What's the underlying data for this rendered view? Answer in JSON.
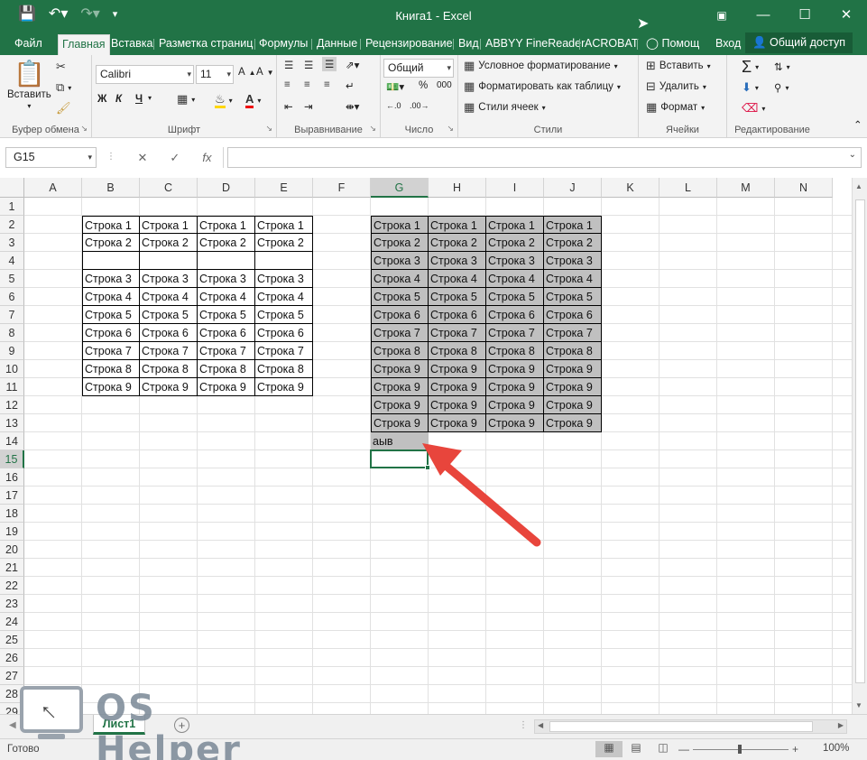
{
  "window": {
    "title": "Книга1 - Excel",
    "qat": [
      "save-icon",
      "undo-icon",
      "redo-icon",
      "customize-icon"
    ],
    "controls": [
      "ribbon-display-icon",
      "minimize-icon",
      "maximize-icon",
      "close-icon"
    ]
  },
  "tabs": [
    "Файл",
    "Главная",
    "Вставка",
    "Разметка страниц",
    "Формулы",
    "Данные",
    "Рецензирование",
    "Вид",
    "ABBYY FineReader",
    "ACROBAT"
  ],
  "tell_me": "Помощ",
  "sign_in": "Вход",
  "share": "Общий доступ",
  "ribbon": {
    "clipboard": {
      "paste": "Вставить",
      "label": "Буфер обмена"
    },
    "font": {
      "name": "Calibri",
      "size": "11",
      "bold": "Ж",
      "italic": "К",
      "underline": "Ч",
      "label": "Шрифт"
    },
    "alignment": {
      "label": "Выравнивание"
    },
    "number": {
      "format": "Общий",
      "label": "Число",
      "percent": "%",
      "thousands": "000"
    },
    "styles": {
      "conditional": "Условное форматирование",
      "as_table": "Форматировать как таблицу",
      "cell_styles": "Стили ячеек",
      "label": "Стили"
    },
    "cells": {
      "insert": "Вставить",
      "delete": "Удалить",
      "format": "Формат",
      "label": "Ячейки"
    },
    "editing": {
      "label": "Редактирование"
    }
  },
  "formula_bar": {
    "name_box": "G15",
    "cancel": "✕",
    "enter": "✓",
    "fx": "fx",
    "content": ""
  },
  "grid": {
    "columns": [
      "A",
      "B",
      "C",
      "D",
      "E",
      "F",
      "G",
      "H",
      "I",
      "J",
      "K",
      "L",
      "M",
      "N"
    ],
    "rows": [
      "1",
      "2",
      "3",
      "4",
      "5",
      "6",
      "7",
      "8",
      "9",
      "10",
      "11",
      "12",
      "13",
      "14",
      "15",
      "16",
      "17",
      "18",
      "19",
      "20",
      "21",
      "22",
      "23",
      "24",
      "25",
      "26",
      "27",
      "28",
      "29"
    ],
    "selected_column": "G",
    "selected_row": "15",
    "left_table": [
      [
        "Строка 1",
        "Строка 1",
        "Строка 1",
        "Строка 1"
      ],
      [
        "Строка 2",
        "Строка 2",
        "Строка 2",
        "Строка 2"
      ],
      [
        "",
        "",
        "",
        ""
      ],
      [
        "Строка 3",
        "Строка 3",
        "Строка 3",
        "Строка 3"
      ],
      [
        "Строка 4",
        "Строка 4",
        "Строка 4",
        "Строка 4"
      ],
      [
        "Строка 5",
        "Строка 5",
        "Строка 5",
        "Строка 5"
      ],
      [
        "Строка 6",
        "Строка 6",
        "Строка 6",
        "Строка 6"
      ],
      [
        "Строка 7",
        "Строка 7",
        "Строка 7",
        "Строка 7"
      ],
      [
        "Строка 8",
        "Строка 8",
        "Строка 8",
        "Строка 8"
      ],
      [
        "Строка 9",
        "Строка 9",
        "Строка 9",
        "Строка 9"
      ]
    ],
    "right_table": [
      [
        "Строка 1",
        "Строка 1",
        "Строка 1",
        "Строка 1"
      ],
      [
        "Строка 2",
        "Строка 2",
        "Строка 2",
        "Строка 2"
      ],
      [
        "Строка 3",
        "Строка 3",
        "Строка 3",
        "Строка 3"
      ],
      [
        "Строка 4",
        "Строка 4",
        "Строка 4",
        "Строка 4"
      ],
      [
        "Строка 5",
        "Строка 5",
        "Строка 5",
        "Строка 5"
      ],
      [
        "Строка 6",
        "Строка 6",
        "Строка 6",
        "Строка 6"
      ],
      [
        "Строка 7",
        "Строка 7",
        "Строка 7",
        "Строка 7"
      ],
      [
        "Строка 8",
        "Строка 8",
        "Строка 8",
        "Строка 8"
      ],
      [
        "Строка 9",
        "Строка 9",
        "Строка 9",
        "Строка 9"
      ],
      [
        "Строка 9",
        "Строка 9",
        "Строка 9",
        "Строка 9"
      ],
      [
        "Строка 9",
        "Строка 9",
        "Строка 9",
        "Строка 9"
      ],
      [
        "Строка 9",
        "Строка 9",
        "Строка 9",
        "Строка 9"
      ]
    ],
    "g14": "аыв"
  },
  "annotation": {
    "arrow_color": "#e8453c"
  },
  "sheets": [
    "Лист1"
  ],
  "status": {
    "ready": "Готово",
    "zoom": "100%"
  },
  "watermark": {
    "text": "OS Helper"
  },
  "colors": {
    "brand": "#217346",
    "highlight": "#c0c0c0"
  }
}
